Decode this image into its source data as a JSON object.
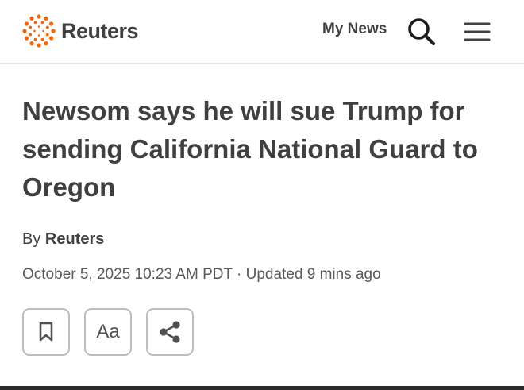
{
  "header": {
    "logo_text": "Reuters",
    "my_news_label": "My News",
    "search_icon": "search-icon",
    "menu_icon": "hamburger-menu-icon",
    "brand_color": "#FA6400"
  },
  "article": {
    "headline": "Newsom says he will sue Trump for sending California National Guard to Oregon",
    "byline_prefix": "By ",
    "byline_author": "Reuters",
    "dateline": "October 5, 2025 10:23 AM PDT · Updated 9 mins ago"
  },
  "actions": {
    "bookmark_icon": "bookmark-icon",
    "text_size_label": "Aa",
    "share_icon": "share-icon"
  }
}
